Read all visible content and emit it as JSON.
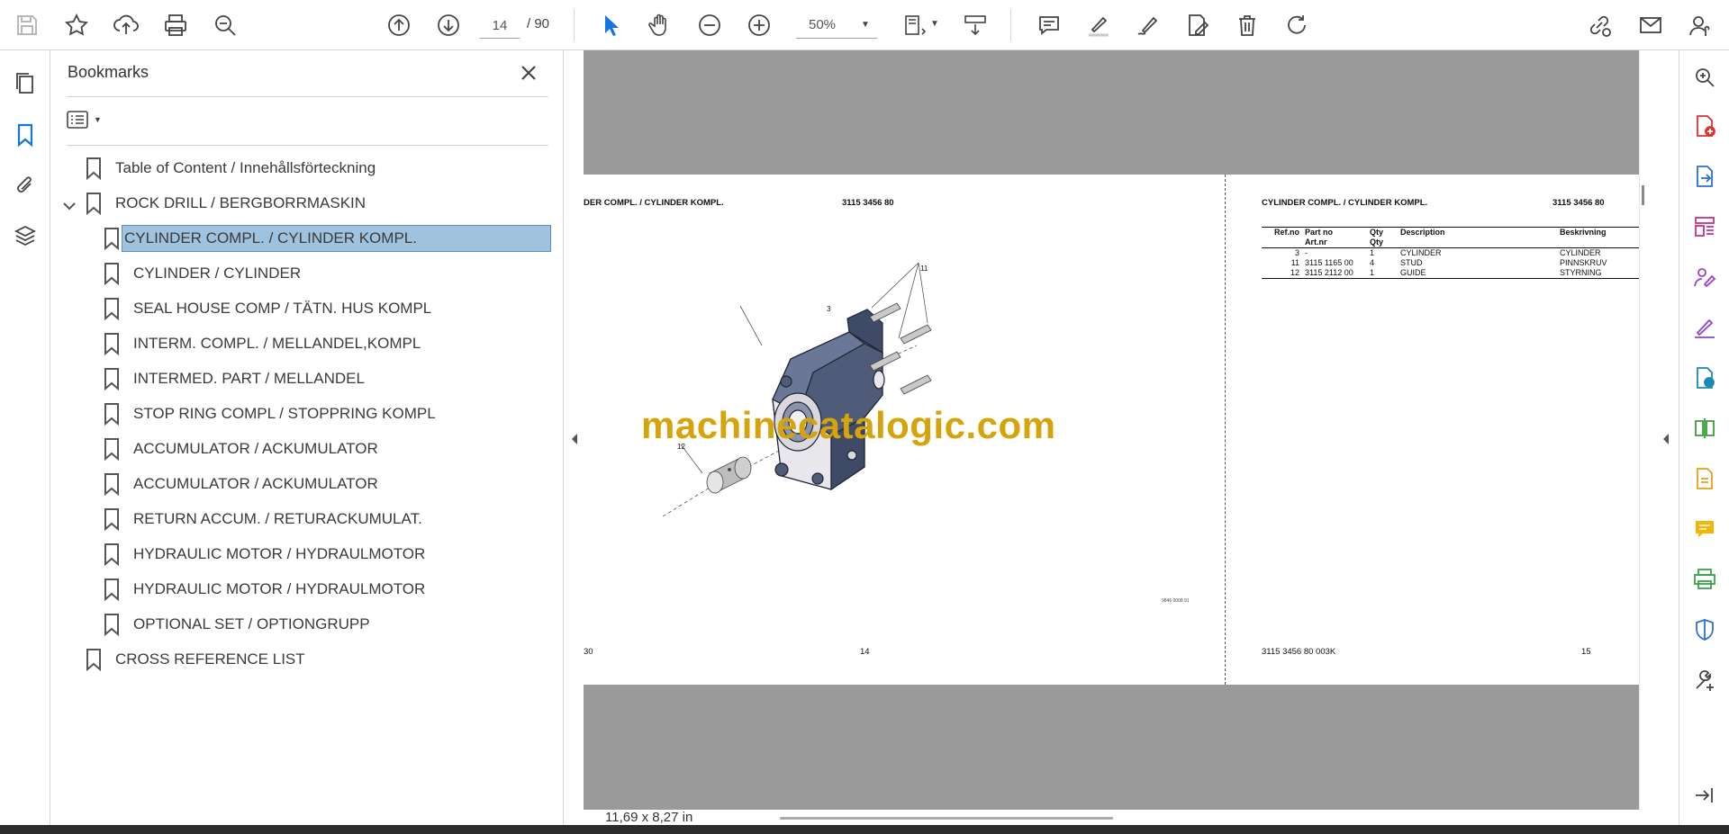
{
  "toolbar": {
    "current_page": "14",
    "page_total": "/ 90",
    "zoom": "50%",
    "icons": [
      "save-icon",
      "star-icon",
      "upload-icon",
      "print-icon",
      "search-zoom-icon",
      "page-up-icon",
      "page-down-icon",
      "select-cursor-icon",
      "hand-icon",
      "zoom-out-icon",
      "zoom-in-icon",
      "page-fit-icon",
      "scroll-mode-icon",
      "comment-icon",
      "highlight-icon",
      "sign-icon",
      "edit-pdf-icon",
      "delete-icon",
      "rotate-icon",
      "share-link-icon",
      "email-icon",
      "account-icon"
    ]
  },
  "bookmarks": {
    "title": "Bookmarks",
    "items": [
      {
        "label": "Table of Content / Innehållsförteckning",
        "level": 0
      },
      {
        "label": "ROCK DRILL / BERGBORRMASKIN",
        "level": 0
      },
      {
        "label": "CYLINDER COMPL.  / CYLINDER KOMPL.",
        "level": 1,
        "selected": true
      },
      {
        "label": "CYLINDER / CYLINDER",
        "level": 1
      },
      {
        "label": "SEAL HOUSE COMP  / TÄTN. HUS KOMPL",
        "level": 1
      },
      {
        "label": "INTERM. COMPL. / MELLANDEL,KOMPL",
        "level": 1
      },
      {
        "label": "INTERMED. PART / MELLANDEL",
        "level": 1
      },
      {
        "label": "STOP RING COMPL  / STOPPRING KOMPL",
        "level": 1
      },
      {
        "label": "ACCUMULATOR / ACKUMULATOR",
        "level": 1
      },
      {
        "label": "ACCUMULATOR / ACKUMULATOR",
        "level": 1
      },
      {
        "label": "RETURN ACCUM. / RETURACKUMULAT.",
        "level": 1
      },
      {
        "label": "HYDRAULIC MOTOR  / HYDRAULMOTOR",
        "level": 1
      },
      {
        "label": "HYDRAULIC MOTOR  / HYDRAULMOTOR",
        "level": 1
      },
      {
        "label": "OPTIONAL SET / OPTIONGRUPP",
        "level": 1
      },
      {
        "label": "CROSS REFERENCE LIST",
        "level": 0
      }
    ]
  },
  "document": {
    "left_page": {
      "header_title": "DER COMPL. / CYLINDER KOMPL.",
      "header_number": "3115 3456 80",
      "callouts": [
        "11",
        "3",
        "12"
      ],
      "drawing_ref": "9846 0008 91",
      "footer_left": "30",
      "page_number": "14"
    },
    "right_page": {
      "header_title": "CYLINDER COMPL. / CYLINDER KOMPL.",
      "header_number": "3115 3456 80",
      "table_headers": {
        "ref": "Ref.no",
        "part": "Part no",
        "part_sv": "Art.nr",
        "qty": "Qty",
        "qty_sv": "Qty",
        "desc": "Description",
        "desc_sv": "Beskrivning"
      },
      "rows": [
        {
          "ref": "3",
          "part": "-",
          "qty": "1",
          "desc": "CYLINDER",
          "desc_sv": "CYLINDER"
        },
        {
          "ref": "11",
          "part": "3115 1165 00",
          "qty": "4",
          "desc": "STUD",
          "desc_sv": "PINNSKRUV"
        },
        {
          "ref": "12",
          "part": "3115 2112 00",
          "qty": "1",
          "desc": "GUIDE",
          "desc_sv": "STYRNING"
        }
      ],
      "footer_code": "3115 3456 80 003K",
      "page_number": "15"
    },
    "watermark": "machinecatalogic.com"
  },
  "status": {
    "page_size": "11,69 x 8,27 in"
  },
  "colors": {
    "accent_blue": "#1473e6",
    "selected_bookmark_bg": "#9fc3de",
    "doc_background": "#9a9a9a",
    "part_fill": "#4f5b78",
    "watermark": "#d4a40a"
  }
}
